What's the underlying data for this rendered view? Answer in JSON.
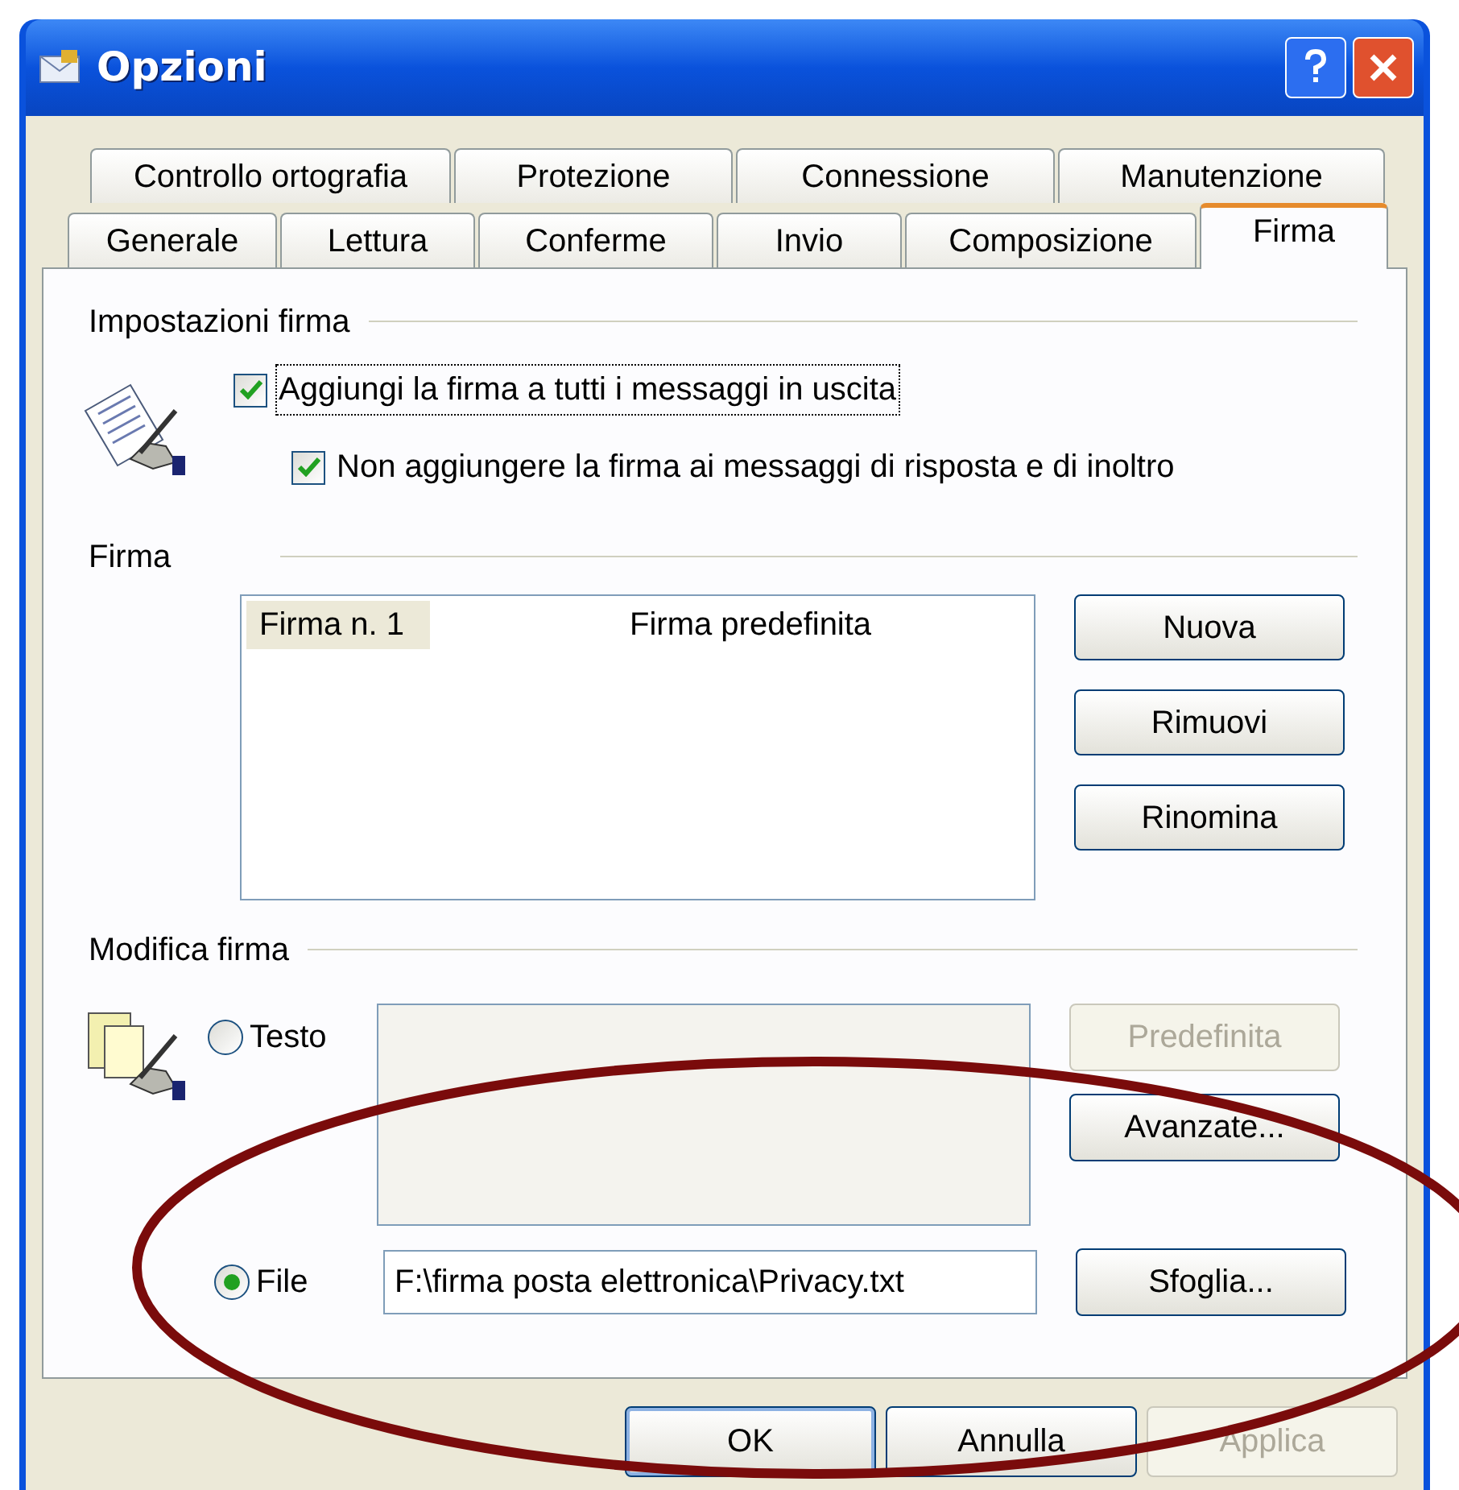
{
  "window": {
    "title": "Opzioni"
  },
  "tab_rows": [
    [
      {
        "label": "Controllo ortografia",
        "selected": false
      },
      {
        "label": "Protezione",
        "selected": false
      },
      {
        "label": "Connessione",
        "selected": false
      },
      {
        "label": "Manutenzione",
        "selected": false
      }
    ],
    [
      {
        "label": "Generale",
        "selected": false
      },
      {
        "label": "Lettura",
        "selected": false
      },
      {
        "label": "Conferme",
        "selected": false
      },
      {
        "label": "Invio",
        "selected": false
      },
      {
        "label": "Composizione",
        "selected": false
      },
      {
        "label": "Firma",
        "selected": true
      }
    ]
  ],
  "settings": {
    "heading": "Impostazioni firma",
    "options": [
      {
        "label": "Aggiungi la firma a tutti i messaggi in uscita",
        "checked": true,
        "focused": true
      },
      {
        "label": "Non aggiungere la firma ai messaggi di risposta e di inoltro",
        "checked": true,
        "focused": false
      }
    ]
  },
  "signatures": {
    "heading": "Firma",
    "list": [
      {
        "name": "Firma n. 1",
        "note": "Firma predefinita",
        "selected": true
      }
    ],
    "buttons": [
      {
        "label": "Nuova",
        "disabled": false
      },
      {
        "label": "Rimuovi",
        "disabled": false
      },
      {
        "label": "Rinomina",
        "disabled": false
      }
    ]
  },
  "edit": {
    "heading": "Modifica firma",
    "sources": [
      {
        "label": "Testo",
        "selected": false
      },
      {
        "label": "File",
        "selected": true
      }
    ],
    "text_box": {
      "disabled": true
    },
    "file_path": "F:\\firma posta elettronica\\Privacy.txt",
    "buttons": [
      {
        "label": "Predefinita",
        "disabled": true
      },
      {
        "label": "Avanzate...",
        "disabled": false
      }
    ],
    "browse_button": {
      "label": "Sfoglia...",
      "disabled": false
    }
  },
  "footer_buttons": [
    {
      "label": "OK",
      "default": true,
      "disabled": false
    },
    {
      "label": "Annulla",
      "default": false,
      "disabled": false
    },
    {
      "label": "Applica",
      "default": false,
      "disabled": true
    }
  ],
  "annotations": [
    {
      "kind": "ellipse"
    }
  ]
}
